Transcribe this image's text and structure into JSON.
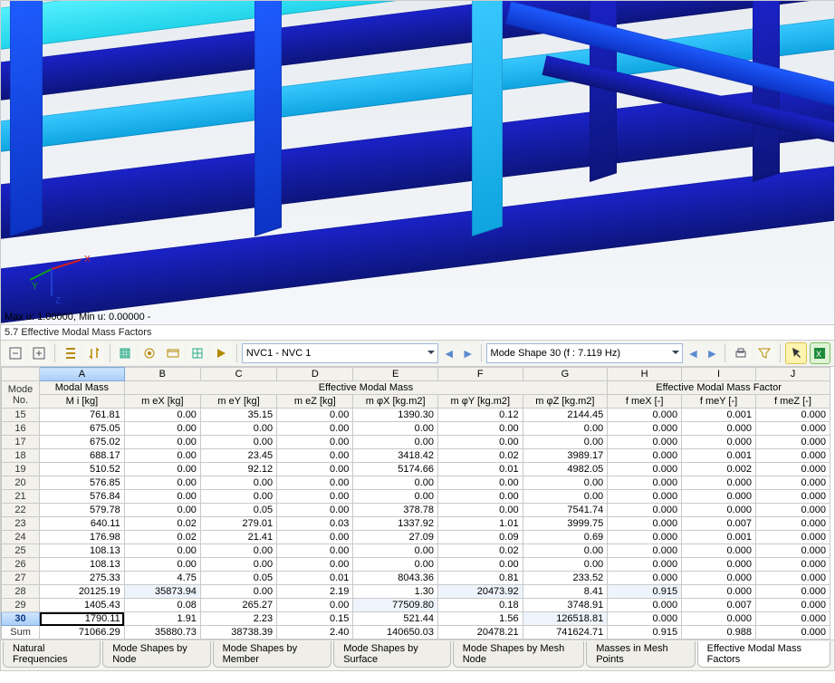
{
  "viewport": {
    "overlay": "Max u: 1.00000, Min u: 0.00000 -"
  },
  "panel": {
    "title": "5.7 Effective Modal Mass Factors"
  },
  "toolbar": {
    "case_combo": "NVC1 - NVC 1",
    "mode_combo": "Mode Shape 30 (f : 7.119 Hz)"
  },
  "grid": {
    "group_headers": {
      "mode": "Mode\nNo.",
      "modal_mass": "Modal Mass",
      "eff_mass": "Effective Modal Mass",
      "eff_factor": "Effective Modal Mass Factor"
    },
    "col_letters": [
      "A",
      "B",
      "C",
      "D",
      "E",
      "F",
      "G",
      "H",
      "I",
      "J"
    ],
    "sub_headers": [
      "M i [kg]",
      "m eX [kg]",
      "m eY [kg]",
      "m eZ [kg]",
      "m φX [kg.m2]",
      "m φY [kg.m2]",
      "m φZ [kg.m2]",
      "f meX [-]",
      "f meY [-]",
      "f meZ [-]"
    ],
    "selected_row_index": 15,
    "rows": [
      {
        "no": "15",
        "a": "761.81",
        "b": "0.00",
        "c": "35.15",
        "d": "0.00",
        "e": "1390.30",
        "f": "0.12",
        "g": "2144.45",
        "h": "0.000",
        "i": "0.001",
        "j": "0.000"
      },
      {
        "no": "16",
        "a": "675.05",
        "b": "0.00",
        "c": "0.00",
        "d": "0.00",
        "e": "0.00",
        "f": "0.00",
        "g": "0.00",
        "h": "0.000",
        "i": "0.000",
        "j": "0.000"
      },
      {
        "no": "17",
        "a": "675.02",
        "b": "0.00",
        "c": "0.00",
        "d": "0.00",
        "e": "0.00",
        "f": "0.00",
        "g": "0.00",
        "h": "0.000",
        "i": "0.000",
        "j": "0.000"
      },
      {
        "no": "18",
        "a": "688.17",
        "b": "0.00",
        "c": "23.45",
        "d": "0.00",
        "e": "3418.42",
        "f": "0.02",
        "g": "3989.17",
        "h": "0.000",
        "i": "0.001",
        "j": "0.000"
      },
      {
        "no": "19",
        "a": "510.52",
        "b": "0.00",
        "c": "92.12",
        "d": "0.00",
        "e": "5174.66",
        "f": "0.01",
        "g": "4982.05",
        "h": "0.000",
        "i": "0.002",
        "j": "0.000"
      },
      {
        "no": "20",
        "a": "576.85",
        "b": "0.00",
        "c": "0.00",
        "d": "0.00",
        "e": "0.00",
        "f": "0.00",
        "g": "0.00",
        "h": "0.000",
        "i": "0.000",
        "j": "0.000"
      },
      {
        "no": "21",
        "a": "576.84",
        "b": "0.00",
        "c": "0.00",
        "d": "0.00",
        "e": "0.00",
        "f": "0.00",
        "g": "0.00",
        "h": "0.000",
        "i": "0.000",
        "j": "0.000"
      },
      {
        "no": "22",
        "a": "579.78",
        "b": "0.00",
        "c": "0.05",
        "d": "0.00",
        "e": "378.78",
        "f": "0.00",
        "g": "7541.74",
        "h": "0.000",
        "i": "0.000",
        "j": "0.000"
      },
      {
        "no": "23",
        "a": "640.11",
        "b": "0.02",
        "c": "279.01",
        "d": "0.03",
        "e": "1337.92",
        "f": "1.01",
        "g": "3999.75",
        "h": "0.000",
        "i": "0.007",
        "j": "0.000"
      },
      {
        "no": "24",
        "a": "176.98",
        "b": "0.02",
        "c": "21.41",
        "d": "0.00",
        "e": "27.09",
        "f": "0.09",
        "g": "0.69",
        "h": "0.000",
        "i": "0.001",
        "j": "0.000"
      },
      {
        "no": "25",
        "a": "108.13",
        "b": "0.00",
        "c": "0.00",
        "d": "0.00",
        "e": "0.00",
        "f": "0.02",
        "g": "0.00",
        "h": "0.000",
        "i": "0.000",
        "j": "0.000"
      },
      {
        "no": "26",
        "a": "108.13",
        "b": "0.00",
        "c": "0.00",
        "d": "0.00",
        "e": "0.00",
        "f": "0.00",
        "g": "0.00",
        "h": "0.000",
        "i": "0.000",
        "j": "0.000"
      },
      {
        "no": "27",
        "a": "275.33",
        "b": "4.75",
        "c": "0.05",
        "d": "0.01",
        "e": "8043.36",
        "f": "0.81",
        "g": "233.52",
        "h": "0.000",
        "i": "0.000",
        "j": "0.000"
      },
      {
        "no": "28",
        "a": "20125.19",
        "b": "35873.94",
        "c": "0.00",
        "d": "2.19",
        "e": "1.30",
        "f": "20473.92",
        "g": "8.41",
        "h": "0.915",
        "i": "0.000",
        "j": "0.000",
        "shade": [
          "b",
          "f",
          "h"
        ]
      },
      {
        "no": "29",
        "a": "1405.43",
        "b": "0.08",
        "c": "265.27",
        "d": "0.00",
        "e": "77509.80",
        "f": "0.18",
        "g": "3748.91",
        "h": "0.000",
        "i": "0.007",
        "j": "0.000",
        "shade": [
          "e"
        ]
      },
      {
        "no": "30",
        "a": "1790.11",
        "b": "1.91",
        "c": "2.23",
        "d": "0.15",
        "e": "521.44",
        "f": "1.56",
        "g": "126518.81",
        "h": "0.000",
        "i": "0.000",
        "j": "0.000",
        "shade": [
          "g"
        ]
      },
      {
        "no": "Sum",
        "a": "71066.29",
        "b": "35880.73",
        "c": "38738.39",
        "d": "2.40",
        "e": "140650.03",
        "f": "20478.21",
        "g": "741624.71",
        "h": "0.915",
        "i": "0.988",
        "j": "0.000",
        "shade": [
          "b",
          "c",
          "e",
          "f",
          "g",
          "h",
          "i"
        ],
        "sum": true
      }
    ]
  },
  "tabs": {
    "items": [
      "Natural Frequencies",
      "Mode Shapes by Node",
      "Mode Shapes by Member",
      "Mode Shapes by Surface",
      "Mode Shapes by Mesh Node",
      "Masses in Mesh Points",
      "Effective Modal Mass Factors"
    ],
    "active_index": 6
  }
}
